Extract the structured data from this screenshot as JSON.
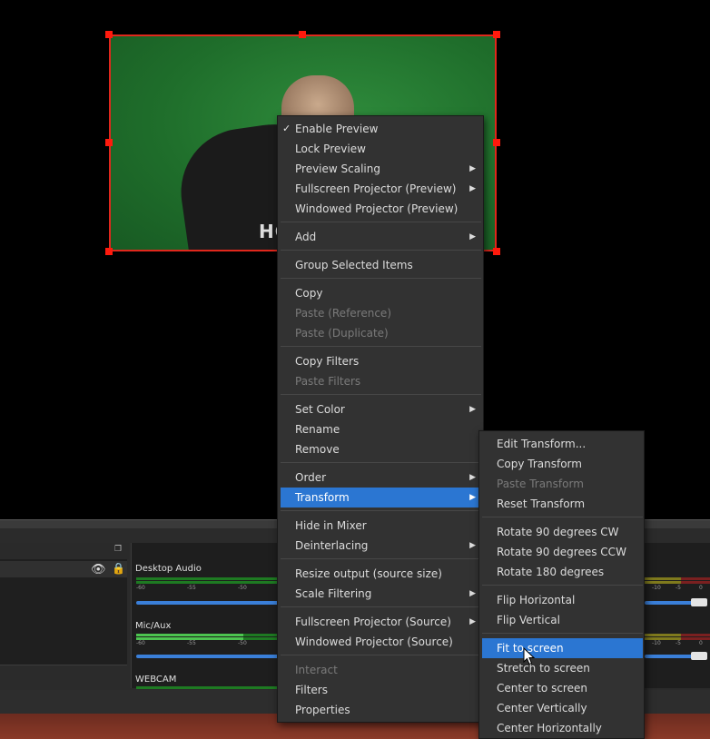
{
  "preview": {
    "chair_text": "HC"
  },
  "context_menu": {
    "items": [
      {
        "label": "Enable Preview",
        "checked": true
      },
      {
        "label": "Lock Preview"
      },
      {
        "label": "Preview Scaling",
        "submenu": true
      },
      {
        "label": "Fullscreen Projector (Preview)",
        "submenu": true
      },
      {
        "label": "Windowed Projector (Preview)"
      },
      {
        "label": "Add",
        "submenu": true
      },
      {
        "label": "Group Selected Items"
      },
      {
        "label": "Copy"
      },
      {
        "label": "Paste (Reference)",
        "disabled": true
      },
      {
        "label": "Paste (Duplicate)",
        "disabled": true
      },
      {
        "label": "Copy Filters"
      },
      {
        "label": "Paste Filters",
        "disabled": true
      },
      {
        "label": "Set Color",
        "submenu": true
      },
      {
        "label": "Rename"
      },
      {
        "label": "Remove"
      },
      {
        "label": "Order",
        "submenu": true
      },
      {
        "label": "Transform",
        "submenu": true,
        "selected": true
      },
      {
        "label": "Hide in Mixer"
      },
      {
        "label": "Deinterlacing",
        "submenu": true
      },
      {
        "label": "Resize output (source size)"
      },
      {
        "label": "Scale Filtering",
        "submenu": true
      },
      {
        "label": "Fullscreen Projector (Source)",
        "submenu": true
      },
      {
        "label": "Windowed Projector (Source)"
      },
      {
        "label": "Interact",
        "disabled": true
      },
      {
        "label": "Filters"
      },
      {
        "label": "Properties"
      }
    ]
  },
  "transform_menu": {
    "items": [
      {
        "label": "Edit Transform..."
      },
      {
        "label": "Copy Transform"
      },
      {
        "label": "Paste Transform",
        "disabled": true
      },
      {
        "label": "Reset Transform"
      },
      {
        "label": "Rotate 90 degrees CW"
      },
      {
        "label": "Rotate 90 degrees CCW"
      },
      {
        "label": "Rotate 180 degrees"
      },
      {
        "label": "Flip Horizontal"
      },
      {
        "label": "Flip Vertical"
      },
      {
        "label": "Fit to screen",
        "hover": true
      },
      {
        "label": "Stretch to screen"
      },
      {
        "label": "Center to screen"
      },
      {
        "label": "Center Vertically"
      },
      {
        "label": "Center Horizontally"
      }
    ]
  },
  "mixer": {
    "channels": [
      {
        "name": "Desktop Audio",
        "volume": 1.0
      },
      {
        "name": "Mic/Aux",
        "volume": 1.0
      },
      {
        "name": "WEBCAM"
      }
    ],
    "scale_ticks": [
      "-60",
      "-55",
      "-50"
    ],
    "right_scale_ticks": [
      "-10",
      "-5",
      "0"
    ],
    "meter_colors": {
      "low": "#1e7a22",
      "high": "#4cc54f",
      "mid": "#7f7a1d",
      "peak": "#7a2020"
    }
  },
  "colors": {
    "accent": "#2b76d2",
    "selection": "#e0271c",
    "menu_bg": "#323232"
  },
  "icons": {
    "check": "check-icon",
    "submenu": "chevron-right-icon",
    "visibility": "eye-icon",
    "lock": "lock-icon",
    "dock_float": "dock-float-icon"
  }
}
